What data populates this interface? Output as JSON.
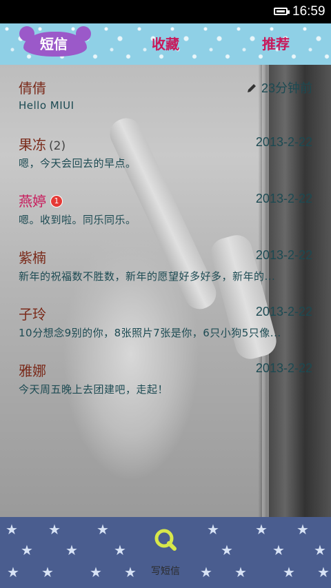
{
  "status_bar": {
    "time": "16:59",
    "battery_level": 1.0
  },
  "tabs": [
    {
      "label": "短信",
      "active": true
    },
    {
      "label": "收藏",
      "active": false
    },
    {
      "label": "推荐",
      "active": false
    }
  ],
  "messages": [
    {
      "name": "倩倩",
      "count": "",
      "badge": "",
      "date": "23分钟前",
      "preview": "Hello MIUI",
      "edited": true
    },
    {
      "name": "果冻",
      "count": "(2)",
      "badge": "",
      "date": "2013-2-22",
      "preview": "嗯，今天会回去的早点。",
      "edited": false
    },
    {
      "name": "燕婷",
      "count": "",
      "badge": "1",
      "date": "2013-2-22",
      "preview": "嗯。收到啦。同乐同乐。",
      "edited": false
    },
    {
      "name": "紫楠",
      "count": "",
      "badge": "",
      "date": "2013-2-22",
      "preview": "新年的祝福数不胜数，新年的愿望好多好多，新年的...",
      "edited": false
    },
    {
      "name": "子玲",
      "count": "",
      "badge": "",
      "date": "2013-2-22",
      "preview": "10分想念9别的你，8张照片7张是你，6只小狗5只像...",
      "edited": false
    },
    {
      "name": "雅娜",
      "count": "",
      "badge": "",
      "date": "2013-2-22",
      "preview": "今天周五晚上去团建吧，走起！",
      "edited": false
    }
  ],
  "bottom_bar": {
    "compose_label": "写短信",
    "compose_icon": "search-compose-icon"
  },
  "colors": {
    "accent": "#c8185a",
    "active_tab": "#9b59c9",
    "bottom_bar": "#4a5d8f",
    "name": "#7a2a1a",
    "text": "#1c4a52",
    "badge": "#e53935"
  }
}
